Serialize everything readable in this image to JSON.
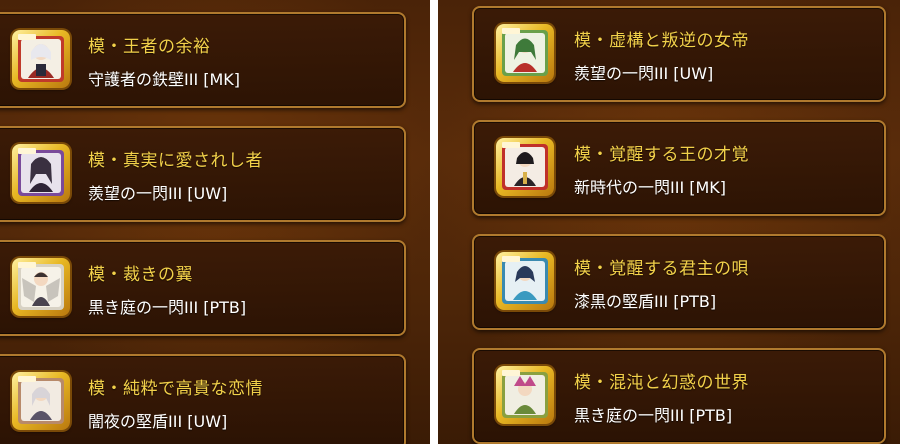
{
  "left_list": [
    {
      "title": "模・王者の余裕",
      "subtitle": "守護者の鉄壁III [MK]",
      "icon": "white-haired-knight-portrait-icon",
      "frame_color": "#c03a2a"
    },
    {
      "title": "模・真実に愛されし者",
      "subtitle": "羨望の一閃III [UW]",
      "icon": "dark-haired-maiden-portrait-icon",
      "frame_color": "#7a4a9a"
    },
    {
      "title": "模・裁きの翼",
      "subtitle": "黒き庭の一閃III [PTB]",
      "icon": "winged-judge-portrait-icon",
      "frame_color": "#d8d2c4"
    },
    {
      "title": "模・純粋で高貴な恋情",
      "subtitle": "闇夜の堅盾III [UW]",
      "icon": "silver-haired-noble-portrait-icon",
      "frame_color": "#b88a6a"
    }
  ],
  "right_list": [
    {
      "title": "模・虚構と叛逆の女帝",
      "subtitle": "羨望の一閃III [UW]",
      "icon": "green-empress-portrait-icon",
      "frame_color": "#6aa04a"
    },
    {
      "title": "模・覚醒する王の才覚",
      "subtitle": "新時代の一閃III [MK]",
      "icon": "dark-king-portrait-icon",
      "frame_color": "#c0302a"
    },
    {
      "title": "模・覚醒する君主の唄",
      "subtitle": "漆黒の堅盾III [PTB]",
      "icon": "blue-sovereign-portrait-icon",
      "frame_color": "#3a8ab0"
    },
    {
      "title": "模・混沌と幻惑の世界",
      "subtitle": "黒き庭の一閃III [PTB]",
      "icon": "chaos-jester-portrait-icon",
      "frame_color": "#8aa040"
    }
  ]
}
